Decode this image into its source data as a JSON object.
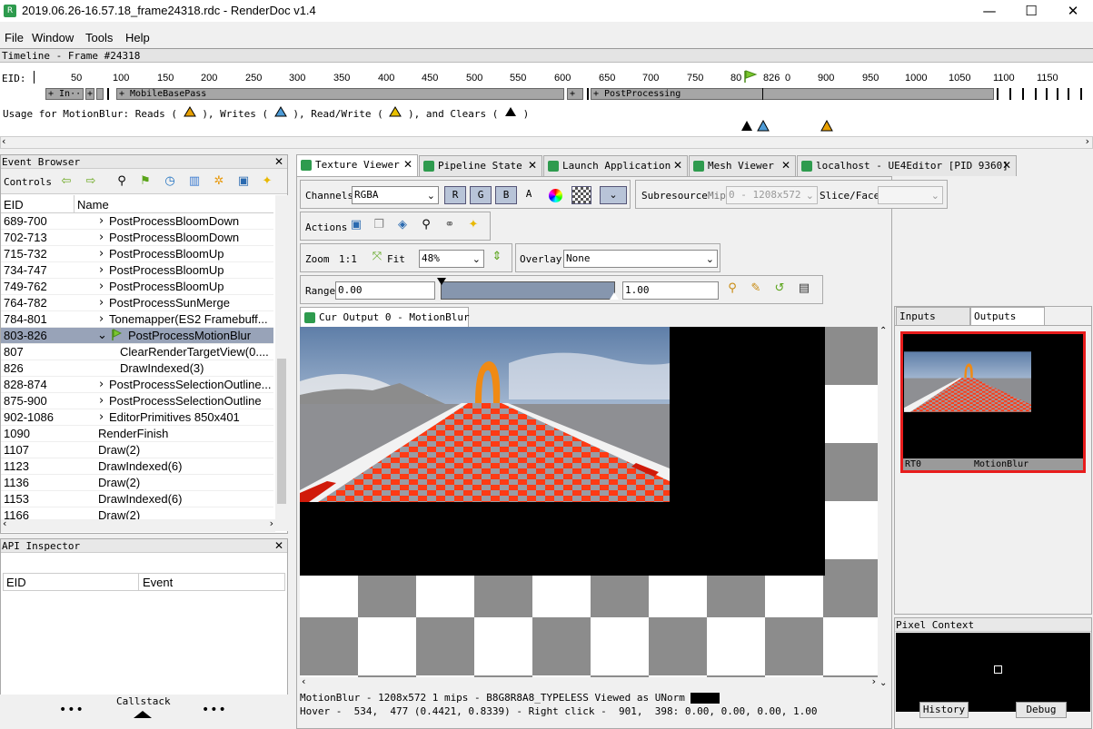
{
  "window": {
    "title": "2019.06.26-16.57.18_frame24318.rdc - RenderDoc v1.4",
    "minimize_glyph": "—",
    "maximize_glyph": "☐",
    "close_glyph": "✕"
  },
  "menu": [
    "File",
    "Window",
    "Tools",
    "Help"
  ],
  "timeline": {
    "header": "Timeline - Frame #24318",
    "eid_label": "EID:",
    "ticks": [
      "50",
      "100",
      "150",
      "200",
      "250",
      "300",
      "350",
      "400",
      "450",
      "500",
      "550",
      "600",
      "650",
      "700",
      "750",
      "80",
      "826",
      "0",
      "900",
      "950",
      "1000",
      "1050",
      "1100",
      "1150"
    ],
    "bars": [
      {
        "label": "+ In···"
      },
      {
        "label": "+"
      },
      {
        "label": "+ MobileBasePass"
      },
      {
        "label": "+"
      },
      {
        "label": "+ PostProcessing"
      }
    ],
    "usage": {
      "prefix": "Usage for MotionBlur: Reads (",
      "writes": "), Writes (",
      "readwrite": "), Read/Write (",
      "clears": "), and Clears (",
      "suffix": ")"
    },
    "marker_colors": {
      "read": "#e8a000",
      "write": "#4d9bd6",
      "readwrite": "#e8c000",
      "clear": "#000000"
    }
  },
  "event_browser": {
    "title": "Event Browser",
    "controls_label": "Controls",
    "columns": [
      "EID",
      "Name"
    ],
    "rows": [
      {
        "eid": "689-700",
        "name": "PostProcessBloomDown",
        "expander": "›"
      },
      {
        "eid": "702-713",
        "name": "PostProcessBloomDown",
        "expander": "›"
      },
      {
        "eid": "715-732",
        "name": "PostProcessBloomUp",
        "expander": "›"
      },
      {
        "eid": "734-747",
        "name": "PostProcessBloomUp",
        "expander": "›"
      },
      {
        "eid": "749-762",
        "name": "PostProcessBloomUp",
        "expander": "›"
      },
      {
        "eid": "764-782",
        "name": "PostProcessSunMerge",
        "expander": "›"
      },
      {
        "eid": "784-801",
        "name": "Tonemapper(ES2 Framebuff...",
        "expander": "›"
      },
      {
        "eid": "803-826",
        "name": "PostProcessMotionBlur",
        "expander": "⌄"
      },
      {
        "eid": "807",
        "name": "ClearRenderTargetView(0....",
        "expander": ""
      },
      {
        "eid": "826",
        "name": "DrawIndexed(3)",
        "expander": ""
      },
      {
        "eid": "828-874",
        "name": "PostProcessSelectionOutline...",
        "expander": "›"
      },
      {
        "eid": "875-900",
        "name": "PostProcessSelectionOutline",
        "expander": "›"
      },
      {
        "eid": "902-1086",
        "name": "EditorPrimitives 850x401",
        "expander": "›"
      },
      {
        "eid": "1090",
        "name": "RenderFinish",
        "expander": ""
      },
      {
        "eid": "1107",
        "name": "Draw(2)",
        "expander": ""
      },
      {
        "eid": "1123",
        "name": "DrawIndexed(6)",
        "expander": ""
      },
      {
        "eid": "1136",
        "name": "Draw(2)",
        "expander": ""
      },
      {
        "eid": "1153",
        "name": "DrawIndexed(6)",
        "expander": ""
      },
      {
        "eid": "1166",
        "name": "Draw(2)",
        "expander": ""
      }
    ],
    "selected_eid": "803-826"
  },
  "api_inspector": {
    "title": "API Inspector",
    "columns": [
      "EID",
      "Event"
    ]
  },
  "callstack": {
    "label": "Callstack",
    "dots": "•••"
  },
  "tabs": [
    {
      "label": "Texture Viewer"
    },
    {
      "label": "Pipeline State"
    },
    {
      "label": "Launch Application"
    },
    {
      "label": "Mesh Viewer"
    },
    {
      "label": "localhost - UE4Editor [PID 9360]"
    }
  ],
  "texture_viewer": {
    "channels_label": "Channels",
    "channels_value": "RGBA",
    "channel_buttons": [
      "R",
      "G",
      "B",
      "A"
    ],
    "subresource_label": "Subresource",
    "mip_label": "Mip",
    "mip_value": "0 - 1208x572",
    "slice_label": "Slice/Face",
    "actions_label": "Actions",
    "zoom_label": "Zoom",
    "zoom_1to1": "1:1",
    "fit_label": "Fit",
    "zoom_value": "48%",
    "overlay_label": "Overlay",
    "overlay_value": "None",
    "range_label": "Range",
    "range_min": "0.00",
    "range_max": "1.00",
    "output_tab": "Cur Output 0 - MotionBlur",
    "status1": "MotionBlur - 1208x572 1 mips - B8G8R8A8_TYPELESS Viewed as UNorm",
    "status2": "Hover -  534,  477 (0.4421, 0.8339) - Right click -  901,  398: 0.00, 0.00, 0.00, 1.00"
  },
  "inputs_outputs": {
    "tabs": [
      "Inputs",
      "Outputs"
    ],
    "thumb_slot": "RT0",
    "thumb_name": "MotionBlur"
  },
  "pixel_context": {
    "title": "Pixel Context",
    "history_button": "History",
    "debug_button": "Debug"
  }
}
